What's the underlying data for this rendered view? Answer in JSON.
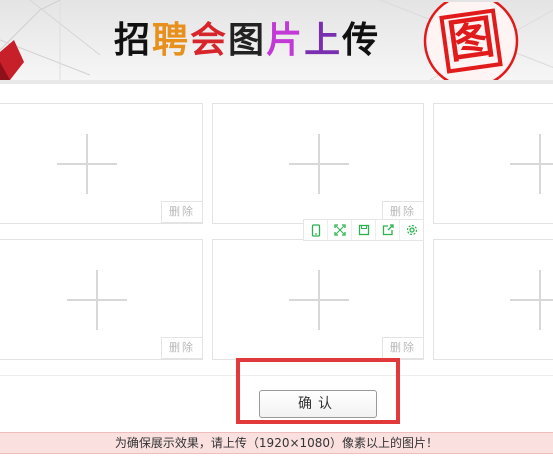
{
  "banner": {
    "title_chars": [
      "招",
      "聘",
      "会",
      "图",
      "片",
      "上",
      "传"
    ],
    "title_colors": [
      "#111111",
      "#e8901e",
      "#d7262b",
      "#222222",
      "#c23ad6",
      "#7a2fb0",
      "#111111"
    ],
    "stamp_char": "图",
    "stamp_color": "#e11b1b"
  },
  "slots": {
    "delete_label": "删除",
    "count": 6
  },
  "toolbar": {
    "icons": [
      "mobile-icon",
      "fullscreen-icon",
      "save-icon",
      "share-icon",
      "settings-icon"
    ],
    "icon_color": "#2bb24c"
  },
  "actions": {
    "confirm_label": "确认"
  },
  "notice": {
    "text": "为确保展示效果，请上传（1920×1080）像素以上的图片！"
  }
}
